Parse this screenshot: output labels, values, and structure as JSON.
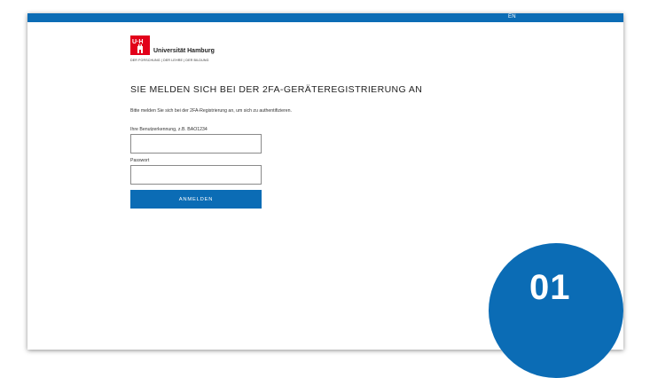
{
  "header": {
    "language_switch": "EN"
  },
  "brand": {
    "logo_letters": "UHH",
    "name": "Universität Hamburg",
    "tagline": "DER FORSCHUNG | DER LEHRE | DER BILDUNG"
  },
  "main": {
    "headline": "SIE MELDEN SICH BEI DER 2FA-GERÄTEREGISTRIERUNG AN",
    "intro": "Bitte melden Sie sich bei der 2FA-Registrierung an, um sich zu authentifizieren.",
    "username": {
      "label": "Ihre Benutzerkennung, z.B. BAO1234",
      "value": ""
    },
    "password": {
      "label": "Passwort",
      "value": ""
    },
    "login_button": "ANMELDEN"
  },
  "overlay": {
    "step_number": "01"
  },
  "colors": {
    "primary_blue": "#0b6cb5",
    "logo_red": "#e2001a"
  }
}
